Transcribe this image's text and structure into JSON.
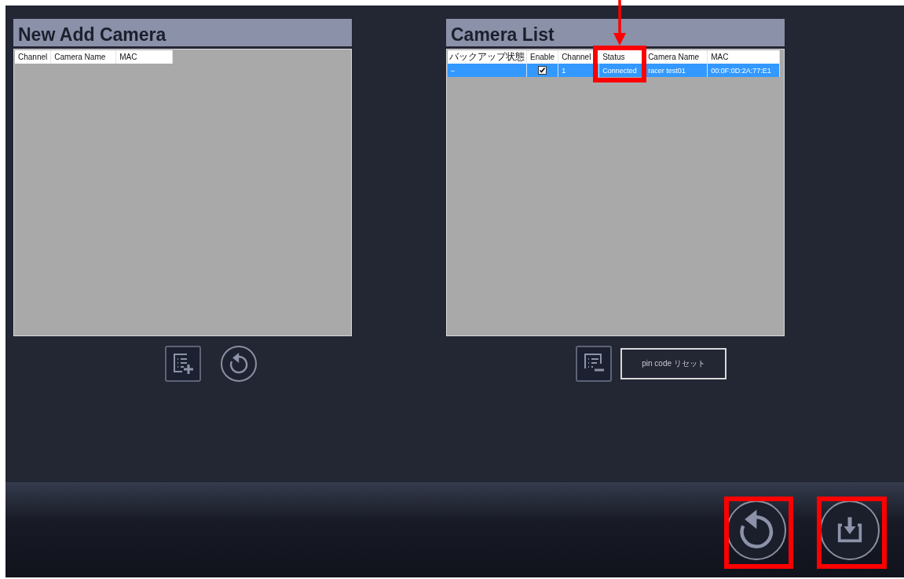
{
  "panels": [
    {
      "title": "New Add Camera",
      "columns": [
        "Channel",
        "Camera Name",
        "MAC"
      ],
      "buttons": [
        {
          "kind": "add-list"
        },
        {
          "kind": "refresh"
        }
      ]
    },
    {
      "title": "Camera List",
      "columns": [
        "バックアップ状態",
        "Enable",
        "Channel",
        "Status",
        "Camera Name",
        "MAC"
      ],
      "rows": [
        {
          "selected": true,
          "backup": "–",
          "enabled": true,
          "channel": "1",
          "status": "Connected",
          "camera_name": "racer test01",
          "mac": "00:0F:0D:2A:77:E1"
        }
      ],
      "buttons": [
        {
          "kind": "remove-list"
        },
        {
          "kind": "text",
          "label": "pin code リセット"
        }
      ]
    }
  ],
  "footer_buttons": [
    {
      "kind": "refresh"
    },
    {
      "kind": "save"
    }
  ]
}
